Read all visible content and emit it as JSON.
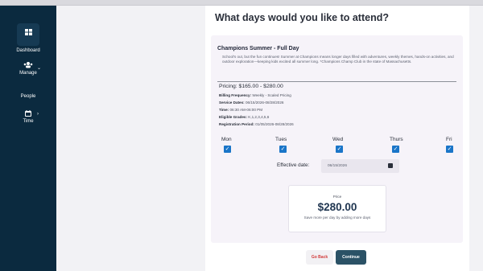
{
  "sidebar": {
    "items": [
      {
        "label": "Dashboard",
        "icon": "dashboard-icon"
      },
      {
        "label": "Manage",
        "icon": "users-icon"
      },
      {
        "label": "People"
      },
      {
        "label": "Time",
        "icon": "calendar-icon"
      }
    ]
  },
  "page": {
    "question": "What days would you like to attend?"
  },
  "program": {
    "title": "Champions Summer - Full Day",
    "description": "School's out, but the fun continues! Summer at Champions means longer days filled with adventures, weekly themes, hands-on activities, and outdoor exploration—keeping kids excited all summer long. *Champions Champ Club in the state of Massachusetts.",
    "pricing": "Pricing: $165.00 - $280.00",
    "billing_label": "Billing Frequency:",
    "billing_value": "Weekly - Scaled Pricing",
    "service_label": "Service Dates:",
    "service_value": "06/15/2026-08/28/2026",
    "time_label": "Time:",
    "time_value": "06:30 AM-06:00 PM",
    "grades_label": "Eligible Grades:",
    "grades_value": "K,1,2,3,4,5,6",
    "registration_label": "Registration Period:",
    "registration_value": "01/05/2026-08/28/2026"
  },
  "days": [
    {
      "label": "Mon",
      "checked": true
    },
    {
      "label": "Tues",
      "checked": true
    },
    {
      "label": "Wed",
      "checked": true
    },
    {
      "label": "Thurs",
      "checked": true
    },
    {
      "label": "Fri",
      "checked": true
    }
  ],
  "effective_date": {
    "label": "Effective date:",
    "value": "06/15/2026"
  },
  "price": {
    "label": "Price",
    "value": "$280.00",
    "note": "Save more per day by adding more days"
  },
  "buttons": {
    "back": "Go Back",
    "continue": "Continue"
  },
  "colors": {
    "sidebar": "#0b2a3f",
    "checkbox": "#1a75c8",
    "continue_button": "#2b5266",
    "back_text": "#d23b3b"
  }
}
